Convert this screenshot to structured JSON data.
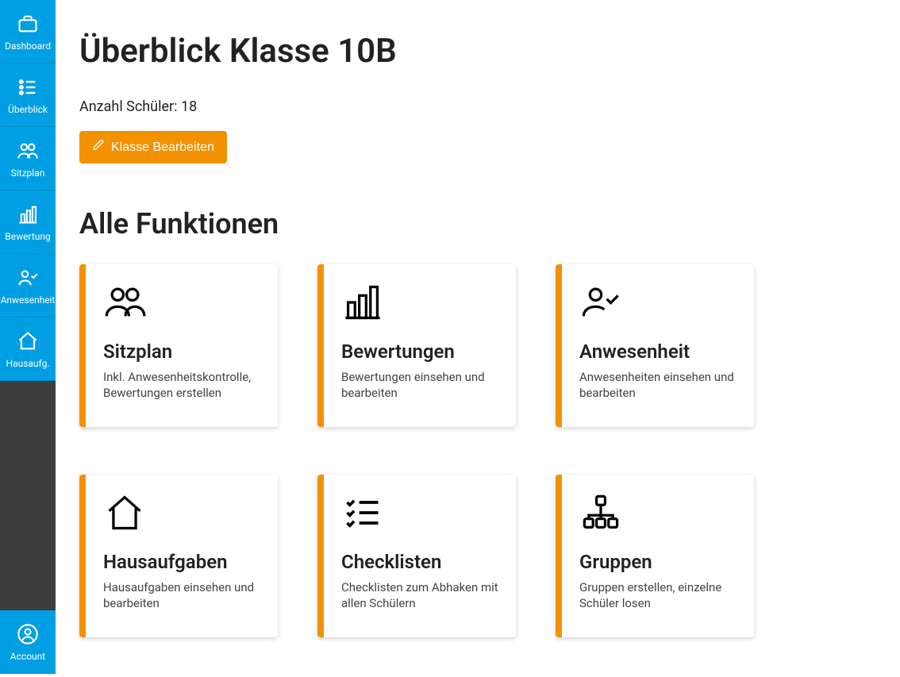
{
  "sidebar": {
    "items": [
      {
        "label": "Dashboard"
      },
      {
        "label": "Überblick"
      },
      {
        "label": "Sitzplan"
      },
      {
        "label": "Bewertung"
      },
      {
        "label": "Anwesenheit"
      },
      {
        "label": "Hausaufg."
      }
    ],
    "account_label": "Account"
  },
  "page": {
    "title": "Überblick Klasse 10B",
    "student_count_text": "Anzahl Schüler: 18",
    "edit_button_label": "Klasse Bearbeiten",
    "section_title": "Alle Funktionen"
  },
  "cards": [
    {
      "title": "Sitzplan",
      "desc": "Inkl. Anwesenheitskontrolle, Bewertungen erstellen"
    },
    {
      "title": "Bewertungen",
      "desc": "Bewertungen einsehen und bearbeiten"
    },
    {
      "title": "Anwesenheit",
      "desc": "Anwesenheiten einsehen und bearbeiten"
    },
    {
      "title": "Hausaufgaben",
      "desc": "Hausaufgaben einsehen und bearbeiten"
    },
    {
      "title": "Checklisten",
      "desc": "Checklisten zum Abhaken mit allen Schülern"
    },
    {
      "title": "Gruppen",
      "desc": "Gruppen erstellen, einzelne Schüler losen"
    }
  ]
}
